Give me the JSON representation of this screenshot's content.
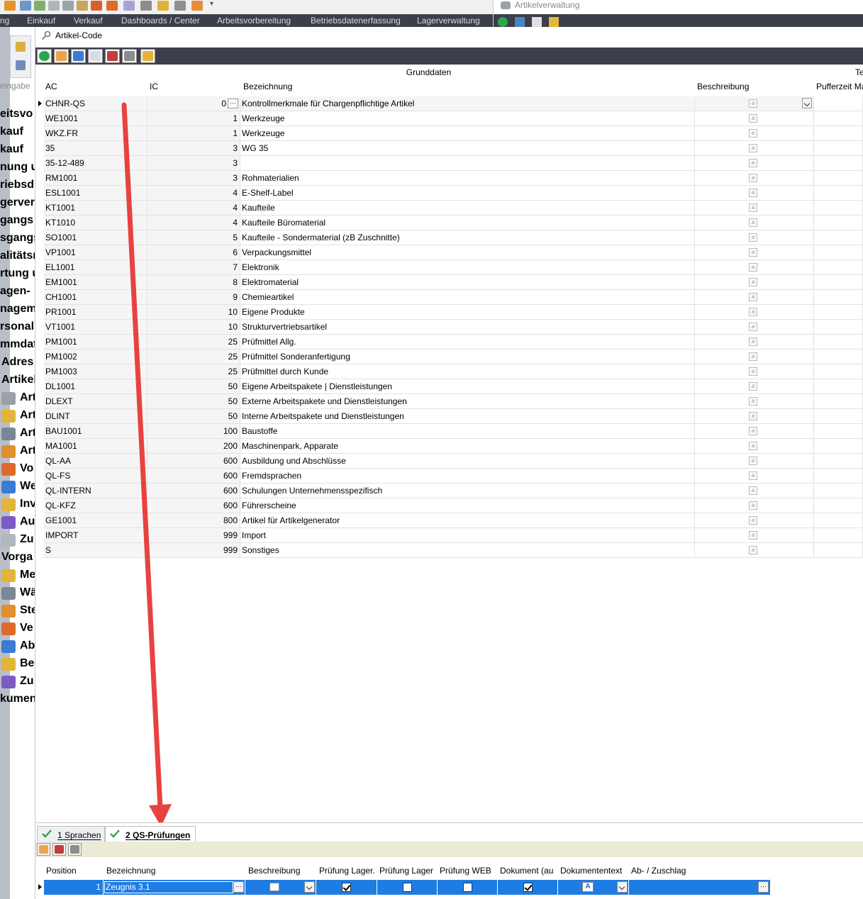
{
  "app": {
    "menu": [
      "ng",
      "Einkauf",
      "Verkauf",
      "Dashboards / Center",
      "Arbeitsvorbereitung",
      "Betriebsdatenerfassung",
      "Lagerverwaltung"
    ],
    "secondary_window_title": "Artikelverwaltung"
  },
  "left_tree": {
    "items": [
      "eitsvo",
      "kauf",
      "kauf",
      "nung u",
      "riebsd",
      "gerver",
      "gangs",
      "sgangs",
      "alitätsn",
      "rtung u",
      "agen- ",
      "nagem",
      "rsonalr",
      "mmdat",
      "Adres",
      "Artikel",
      "Art",
      "Art",
      "Art",
      "Art",
      "Vo",
      "We",
      "Inv",
      "Au",
      "Zu",
      "Vorga",
      "Me",
      "Wä",
      "Ste",
      "Ve",
      "Ab",
      "Be",
      "Zu",
      "kumen"
    ],
    "search_hint": "eingabe"
  },
  "window": {
    "title": "Artikel-Code"
  },
  "grid": {
    "band_grunddaten": "Grunddaten",
    "band_termin": "Term",
    "columns": {
      "ac": "AC",
      "ic": "IC",
      "bezeichnung": "Bezeichnung",
      "beschreibung": "Beschreibung",
      "pufferzeit": "Pufferzeit Ma"
    },
    "rows": [
      {
        "ac": "CHNR-QS",
        "ic": "0",
        "bez": "Kontrollmerkmale für Chargenpflichtige Artikel"
      },
      {
        "ac": "WE1001",
        "ic": "1",
        "bez": "Werkzeuge"
      },
      {
        "ac": "WKZ.FR",
        "ic": "1",
        "bez": "Werkzeuge"
      },
      {
        "ac": "35",
        "ic": "3",
        "bez": "WG 35"
      },
      {
        "ac": "35-12-489",
        "ic": "3",
        "bez": ""
      },
      {
        "ac": "RM1001",
        "ic": "3",
        "bez": "Rohmaterialien"
      },
      {
        "ac": "ESL1001",
        "ic": "4",
        "bez": "E-Shelf-Label"
      },
      {
        "ac": "KT1001",
        "ic": "4",
        "bez": "Kaufteile"
      },
      {
        "ac": "KT1010",
        "ic": "4",
        "bez": "Kaufteile Büromaterial"
      },
      {
        "ac": "SO1001",
        "ic": "5",
        "bez": "Kaufteile - Sondermaterial (zB Zuschnitte)"
      },
      {
        "ac": "VP1001",
        "ic": "6",
        "bez": "Verpackungsmittel"
      },
      {
        "ac": "EL1001",
        "ic": "7",
        "bez": "Elektronik"
      },
      {
        "ac": "EM1001",
        "ic": "8",
        "bez": "Elektromaterial"
      },
      {
        "ac": "CH1001",
        "ic": "9",
        "bez": "Chemieartikel"
      },
      {
        "ac": "PR1001",
        "ic": "10",
        "bez": "Eigene Produkte"
      },
      {
        "ac": "VT1001",
        "ic": "10",
        "bez": "Strukturvertriebsartikel"
      },
      {
        "ac": "PM1001",
        "ic": "25",
        "bez": "Prüfmittel Allg."
      },
      {
        "ac": "PM1002",
        "ic": "25",
        "bez": "Prüfmittel Sonderanfertigung"
      },
      {
        "ac": "PM1003",
        "ic": "25",
        "bez": "Prüfmittel durch Kunde"
      },
      {
        "ac": "DL1001",
        "ic": "50",
        "bez": "Eigene Arbeitspakete | Dienstleistungen"
      },
      {
        "ac": "DLEXT",
        "ic": "50",
        "bez": "Externe Arbeitspakete und Dienstleistungen"
      },
      {
        "ac": "DLINT",
        "ic": "50",
        "bez": "Interne Arbeitspakete und Dienstleistungen"
      },
      {
        "ac": "BAU1001",
        "ic": "100",
        "bez": "Baustoffe"
      },
      {
        "ac": "MA1001",
        "ic": "200",
        "bez": "Maschinenpark, Apparate"
      },
      {
        "ac": "QL-AA",
        "ic": "600",
        "bez": "Ausbildung und Abschlüsse"
      },
      {
        "ac": "QL-FS",
        "ic": "600",
        "bez": "Fremdsprachen"
      },
      {
        "ac": "QL-INTERN",
        "ic": "600",
        "bez": "Schulungen Unternehmensspezifisch"
      },
      {
        "ac": "QL-KFZ",
        "ic": "600",
        "bez": "Führerscheine"
      },
      {
        "ac": "GE1001",
        "ic": "800",
        "bez": "Artikel für Artikelgenerator"
      },
      {
        "ac": "IMPORT",
        "ic": "999",
        "bez": "Import"
      },
      {
        "ac": "S",
        "ic": "999",
        "bez": "Sonstiges"
      }
    ]
  },
  "tabs": [
    {
      "label": "1 Sprachen",
      "active": false
    },
    {
      "label": "2 QS-Prüfungen",
      "active": true
    }
  ],
  "subgrid": {
    "columns": {
      "position": "Position",
      "bezeichnung": "Bezeichnung",
      "beschreibung": "Beschreibung",
      "pruefung_lager1": "Prüfung Lager.",
      "pruefung_lager2": "Prüfung Lager",
      "pruefung_web": "Prüfung WEB",
      "dokument": "Dokument (au",
      "dokumententext": "Dokumententext",
      "ab_zuschlag": "Ab- / Zuschlag"
    },
    "row": {
      "position": "1",
      "bezeichnung": "Zeugnis 3.1",
      "pruefung_lager1": true,
      "pruefung_lager2": false,
      "pruefung_web": false,
      "dokument": true
    }
  },
  "colors": {
    "toolbar_dark": "#3c3f4a",
    "selection_blue": "#1e7ce3",
    "annotation_arrow": "#e8423f"
  }
}
